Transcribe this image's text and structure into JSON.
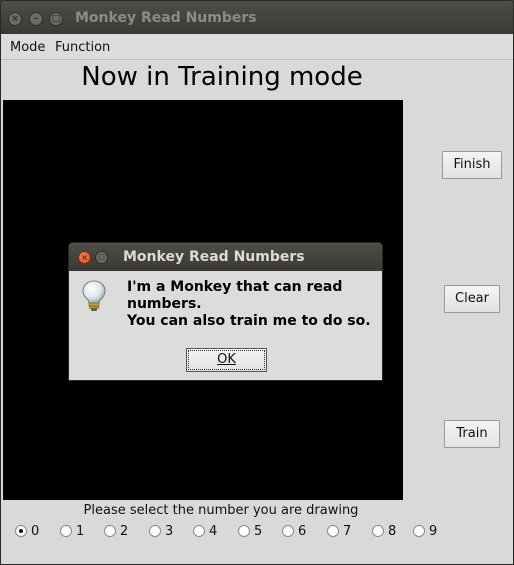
{
  "window": {
    "title": "Monkey Read Numbers",
    "controls": [
      "close-icon",
      "minimize-icon",
      "maximize-icon"
    ]
  },
  "menubar": {
    "items": [
      "Mode",
      "Function"
    ]
  },
  "main": {
    "heading": "Now in Training mode",
    "buttons": {
      "finish": "Finish",
      "clear": "Clear",
      "train": "Train"
    },
    "prompt": "Please select the number you are drawing",
    "digits": [
      "0",
      "1",
      "2",
      "3",
      "4",
      "5",
      "6",
      "7",
      "8",
      "9"
    ],
    "selected_digit": "0"
  },
  "dialog": {
    "title": "Monkey Read Numbers",
    "icon": "lightbulb-icon",
    "message_lines": [
      "I'm a Monkey that can read",
      "numbers.",
      "You can also train me to do so."
    ],
    "ok_label": "OK"
  },
  "colors": {
    "titlebar": "#3c3b37",
    "window_bg": "#d9d9d9",
    "canvas": "#000000",
    "close_button": "#e0531f"
  }
}
